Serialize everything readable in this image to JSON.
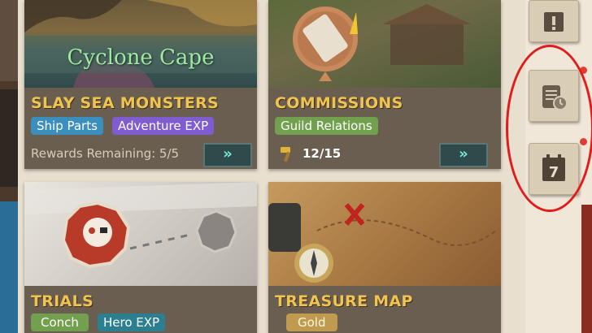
{
  "cards": {
    "sea_monsters": {
      "location_label": "Cyclone Cape",
      "title": "SLAY SEA MONSTERS",
      "tags": [
        "Ship Parts",
        "Adventure EXP"
      ],
      "rewards_text": "Rewards Remaining: 5/5",
      "go_label": "»"
    },
    "commissions": {
      "title": "COMMISSIONS",
      "tags": [
        "Guild Relations"
      ],
      "count_text": "12/15",
      "go_label": "»"
    },
    "trials": {
      "title": "TRIALS",
      "tags": [
        "Conch",
        "Hero EXP"
      ]
    },
    "treasure_map": {
      "title": "TREASURE MAP",
      "tags": [
        "Gold"
      ]
    }
  },
  "side_buttons": [
    {
      "icon": "notice-board-icon",
      "has_alert": false
    },
    {
      "icon": "scroll-clock-icon",
      "has_alert": true
    },
    {
      "icon": "calendar-7-icon",
      "calendar_number": "7",
      "has_alert": true
    }
  ],
  "colors": {
    "title_gold": "#f1c44f",
    "card_bg": "#6a5e51",
    "annotation_red": "#e21b1b"
  }
}
